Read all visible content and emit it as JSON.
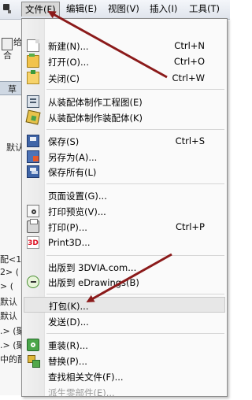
{
  "menubar": {
    "items": [
      {
        "label": "文件(F)"
      },
      {
        "label": "编辑(E)"
      },
      {
        "label": "视图(V)"
      },
      {
        "label": "插入(I)"
      },
      {
        "label": "工具(T)"
      }
    ]
  },
  "background": {
    "fragments": [
      "给",
      "合",
      "草",
      "默认",
      "配<1",
      "2> (",
      "> (",
      "默认",
      "默认",
      ".> (聚",
      ".> (聚",
      "中的配"
    ]
  },
  "file_menu": {
    "new": {
      "label": "新建(N)...",
      "shortcut": "Ctrl+N",
      "icon": "new-document-icon"
    },
    "open": {
      "label": "打开(O)...",
      "shortcut": "Ctrl+O",
      "icon": "open-folder-icon"
    },
    "close": {
      "label": "关闭(C)",
      "shortcut": "Ctrl+W",
      "icon": "close-folder-icon"
    },
    "make_drawing": {
      "label": "从装配体制作工程图(E)",
      "icon": "drawing-icon"
    },
    "make_assembly": {
      "label": "从装配体制作装配体(K)",
      "icon": "assembly-icon"
    },
    "save": {
      "label": "保存(S)",
      "shortcut": "Ctrl+S",
      "icon": "save-icon"
    },
    "save_as": {
      "label": "另存为(A)...",
      "icon": "save-as-icon"
    },
    "save_all": {
      "label": "保存所有(L)",
      "icon": "save-all-icon"
    },
    "page_setup": {
      "label": "页面设置(G)..."
    },
    "print_preview": {
      "label": "打印预览(V)...",
      "icon": "print-preview-icon"
    },
    "print": {
      "label": "打印(P)...",
      "shortcut": "Ctrl+P",
      "icon": "printer-icon"
    },
    "print3d": {
      "label": "Print3D...",
      "icon": "print3d-icon"
    },
    "publish_3dvia": {
      "label": "出版到 3DVIA.com..."
    },
    "publish_edrawings": {
      "label": "出版到 eDrawings(B)",
      "icon": "edrawings-icon"
    },
    "pack_and_go": {
      "label": "打包(K)..."
    },
    "send": {
      "label": "发送(D)..."
    },
    "reload": {
      "label": "重装(R)...",
      "icon": "reload-icon"
    },
    "replace": {
      "label": "替换(P)...",
      "icon": "replace-icon"
    },
    "find_references": {
      "label": "查找相关文件(F)..."
    },
    "derive_part": {
      "label": "派生零部件(E)..."
    }
  },
  "colors": {
    "annotation_arrow": "#8b1a1a"
  }
}
